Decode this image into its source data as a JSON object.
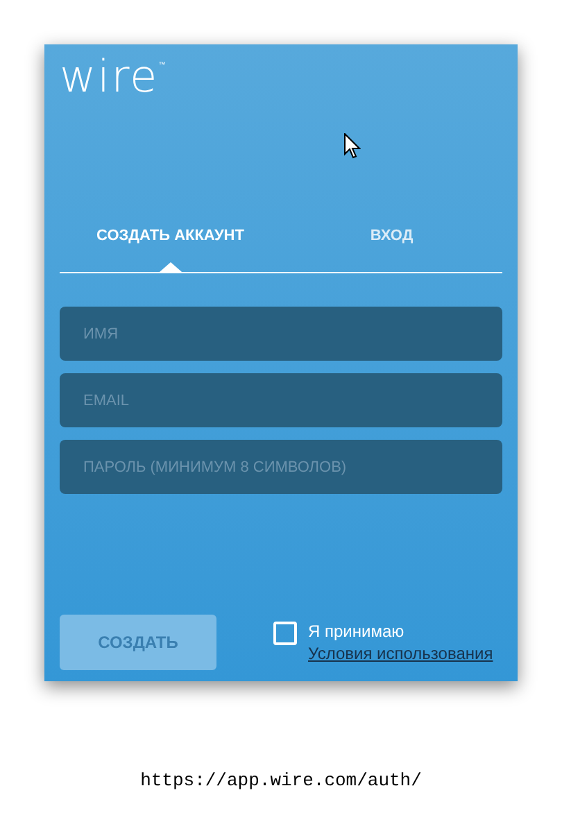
{
  "logo": {
    "text": "wire",
    "mark": "™"
  },
  "tabs": [
    {
      "label": "СОЗДАТЬ АККАУНТ",
      "selected": true
    },
    {
      "label": "ВХОД",
      "selected": false
    }
  ],
  "fields": [
    {
      "placeholder": "ИМЯ"
    },
    {
      "placeholder": "EMAIL"
    },
    {
      "placeholder": "ПАРОЛЬ (МИНИМУМ 8 СИМВОЛОВ)"
    }
  ],
  "submit_button": {
    "label": "СОЗДАТЬ",
    "disabled": true
  },
  "terms": {
    "checked": false,
    "text": "Я принимаю",
    "link": "Условия использования"
  },
  "caption": "https://app.wire.com/auth/"
}
